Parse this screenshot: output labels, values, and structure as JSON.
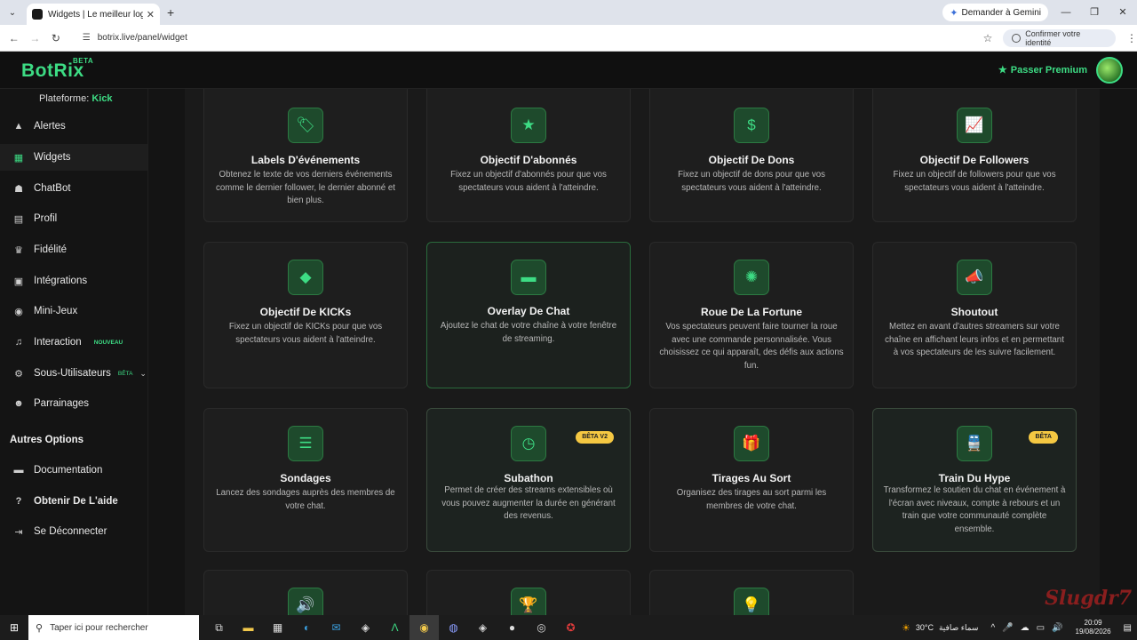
{
  "browser": {
    "tab_title": "Widgets | Le meilleur logiciel p",
    "gemini_label": "Demander à Gemini",
    "url": "botrix.live/panel/widget",
    "confirm_label": "Confirmer votre identité"
  },
  "header": {
    "logo": "BotRix",
    "logo_badge": "BETA",
    "premium_label": "Passer Premium"
  },
  "sidebar": {
    "platform_label": "Plateforme:",
    "platform_value": "Kick",
    "items": [
      {
        "label": "Alertes",
        "icon": "warning-icon"
      },
      {
        "label": "Widgets",
        "icon": "widgets-icon"
      },
      {
        "label": "ChatBot",
        "icon": "robot-icon"
      },
      {
        "label": "Profil",
        "icon": "id-card-icon"
      },
      {
        "label": "Fidélité",
        "icon": "trophy-icon"
      },
      {
        "label": "Intégrations",
        "icon": "integration-icon"
      },
      {
        "label": "Mini-Jeux",
        "icon": "gamepad-icon"
      },
      {
        "label": "Interaction",
        "icon": "music-icon",
        "tag": "NOUVEAU"
      },
      {
        "label": "Sous-Utilisateurs",
        "icon": "users-icon",
        "tag": "BÊTA"
      },
      {
        "label": "Parrainages",
        "icon": "referral-icon"
      }
    ],
    "section_title": "Autres Options",
    "other_items": [
      {
        "label": "Documentation",
        "icon": "document-icon"
      },
      {
        "label": "Obtenir De L'aide",
        "icon": "help-icon"
      },
      {
        "label": "Se Déconnecter",
        "icon": "logout-icon"
      }
    ]
  },
  "cards": [
    {
      "title": "Labels D'événements",
      "desc": "Obtenez le texte de vos derniers événements comme le dernier follower, le dernier abonné et bien plus.",
      "icon": "tag-icon"
    },
    {
      "title": "Objectif D'abonnés",
      "desc": "Fixez un objectif d'abonnés pour que vos spectateurs vous aident à l'atteindre.",
      "icon": "star-icon"
    },
    {
      "title": "Objectif De Dons",
      "desc": "Fixez un objectif de dons pour que vos spectateurs vous aident à l'atteindre.",
      "icon": "dollar-icon"
    },
    {
      "title": "Objectif De Followers",
      "desc": "Fixez un objectif de followers pour que vos spectateurs vous aident à l'atteindre.",
      "icon": "chart-icon"
    },
    {
      "title": "Objectif De KICKs",
      "desc": "Fixez un objectif de KICKs pour que vos spectateurs vous aident à l'atteindre.",
      "icon": "gem-icon"
    },
    {
      "title": "Overlay De Chat",
      "desc": "Ajoutez le chat de votre chaîne à votre fenêtre de streaming.",
      "icon": "chat-icon"
    },
    {
      "title": "Roue De La Fortune",
      "desc": "Vos spectateurs peuvent faire tourner la roue avec une commande personnalisée. Vous choisissez ce qui apparaît, des défis aux actions fun.",
      "icon": "wheel-icon"
    },
    {
      "title": "Shoutout",
      "desc": "Mettez en avant d'autres streamers sur votre chaîne en affichant leurs infos et en permettant à vos spectateurs de les suivre facilement.",
      "icon": "megaphone-icon"
    },
    {
      "title": "Sondages",
      "desc": "Lancez des sondages auprès des membres de votre chat.",
      "icon": "poll-icon"
    },
    {
      "title": "Subathon",
      "desc": "Permet de créer des streams extensibles où vous pouvez augmenter la durée en générant des revenus.",
      "icon": "clock-icon",
      "badge": "BÊTA V2"
    },
    {
      "title": "Tirages Au Sort",
      "desc": "Organisez des tirages au sort parmi les membres de votre chat.",
      "icon": "gift-icon"
    },
    {
      "title": "Train Du Hype",
      "desc": "Transformez le soutien du chat en événement à l'écran avec niveaux, compte à rebours et un train que votre communauté complète ensemble.",
      "icon": "train-icon",
      "badge": "BÊTA"
    }
  ],
  "partial_cards_icons": [
    "speaker-icon",
    "trophy-icon",
    "bulb-icon"
  ],
  "taskbar": {
    "search_placeholder": "Taper ici pour rechercher",
    "weather": "30°C",
    "weather_text": "سماء صافية",
    "time": "20:09",
    "date": "19/08/2026"
  },
  "watermark": "Slugdr7"
}
